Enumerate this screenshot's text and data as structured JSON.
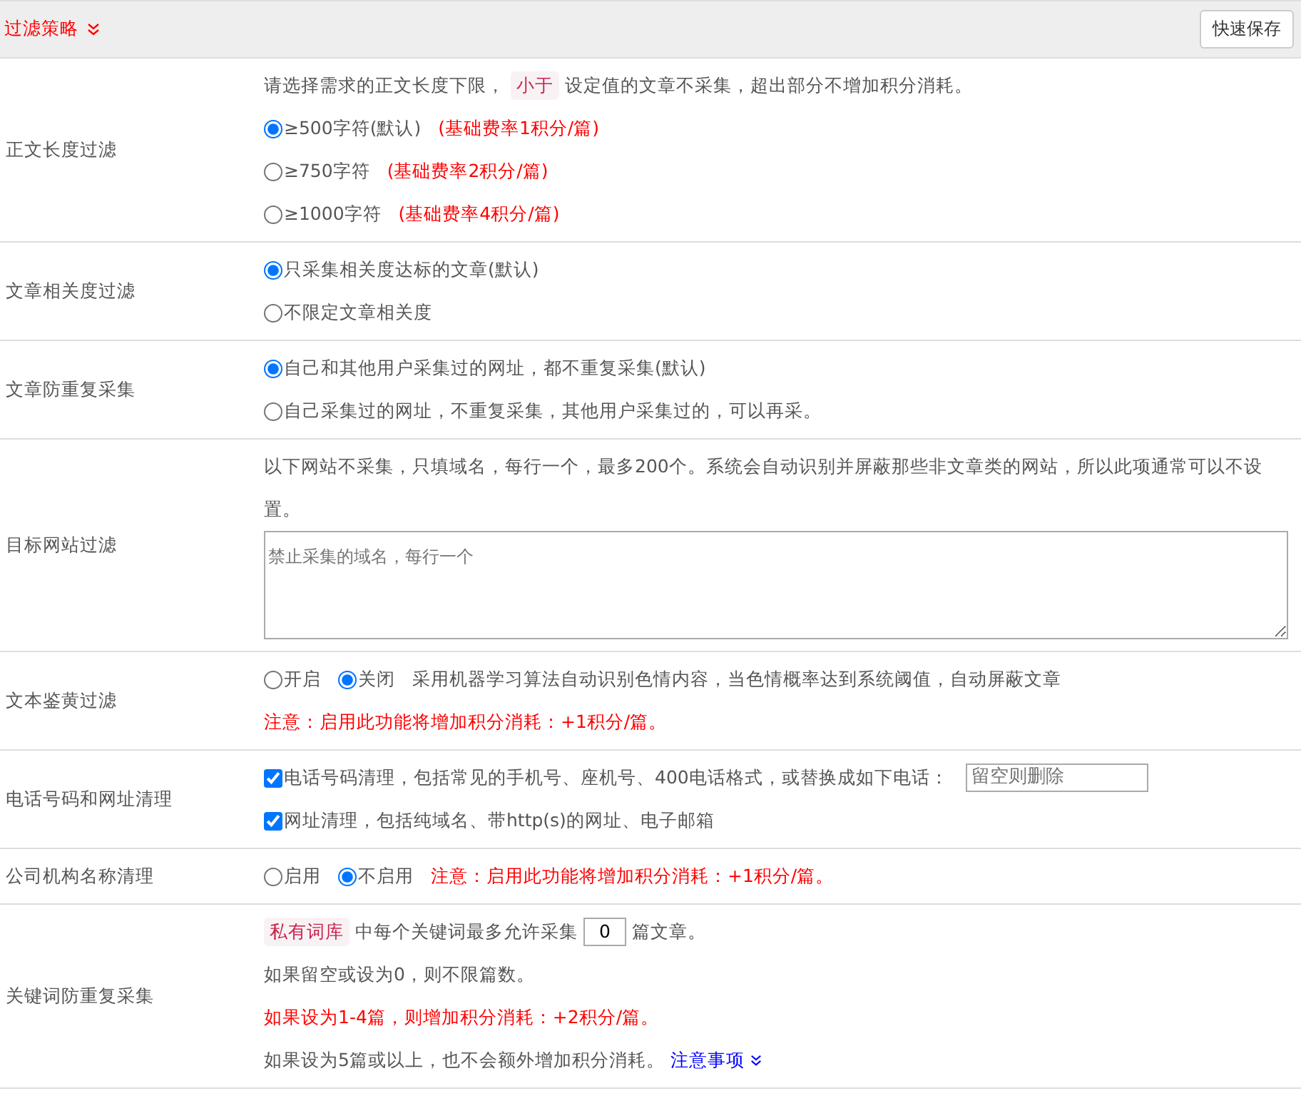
{
  "header": {
    "title": "过滤策略",
    "save_button": "快速保存"
  },
  "rows": [
    {
      "label": "正文长度过滤",
      "lines": [
        [
          {
            "kind": "text",
            "text": "请选择需求的正文长度下限，"
          },
          {
            "kind": "tag",
            "text": "小于"
          },
          {
            "kind": "text",
            "text": "设定值的文章不采集，超出部分不增加积分消耗。"
          }
        ],
        [
          {
            "kind": "radio",
            "label": "≥500字符(默认)",
            "selected": true
          },
          {
            "kind": "notice",
            "text": "(基础费率1积分/篇)"
          }
        ],
        [
          {
            "kind": "radio",
            "label": "≥750字符",
            "selected": false
          },
          {
            "kind": "notice",
            "text": "(基础费率2积分/篇)"
          }
        ],
        [
          {
            "kind": "radio",
            "label": "≥1000字符",
            "selected": false
          },
          {
            "kind": "notice",
            "text": "(基础费率4积分/篇)"
          }
        ]
      ]
    },
    {
      "label": "文章相关度过滤",
      "lines": [
        [
          {
            "kind": "radio",
            "label": "只采集相关度达标的文章(默认)",
            "selected": true
          }
        ],
        [
          {
            "kind": "radio",
            "label": "不限定文章相关度",
            "selected": false
          }
        ]
      ]
    },
    {
      "label": "文章防重复采集",
      "lines": [
        [
          {
            "kind": "radio",
            "label": "自己和其他用户采集过的网址，都不重复采集(默认)",
            "selected": true
          }
        ],
        [
          {
            "kind": "radio",
            "label": "自己采集过的网址，不重复采集，其他用户采集过的，可以再采。",
            "selected": false
          }
        ]
      ]
    },
    {
      "label": "目标网站过滤",
      "lines": [
        [
          {
            "kind": "text",
            "text": "以下网站不采集，只填域名，每行一个，最多200个。系统会自动识别并屏蔽那些非文章类的网站，所以此项通常可以不设置。"
          }
        ],
        [
          {
            "kind": "textarea",
            "placeholder": "禁止采集的域名，每行一个"
          }
        ]
      ]
    },
    {
      "label": "文本鉴黄过滤",
      "lines": [
        [
          {
            "kind": "radio",
            "label": "开启",
            "selected": false
          },
          {
            "kind": "radio",
            "label": "关闭",
            "selected": true
          },
          {
            "kind": "text",
            "text": "采用机器学习算法自动识别色情内容，当色情概率达到系统阈值，自动屏蔽文章"
          }
        ],
        [
          {
            "kind": "notice",
            "text": "注意：启用此功能将增加积分消耗：+1积分/篇。"
          }
        ]
      ]
    },
    {
      "label": "电话号码和网址清理",
      "lines": [
        [
          {
            "kind": "checkbox",
            "label": "电话号码清理，包括常见的手机号、座机号、400电话格式，或替换成如下电话：",
            "checked": true
          },
          {
            "kind": "input",
            "placeholder": "留空则删除"
          }
        ],
        [
          {
            "kind": "checkbox",
            "label": "网址清理，包括纯域名、带http(s)的网址、电子邮箱",
            "checked": true
          }
        ]
      ]
    },
    {
      "label": "公司机构名称清理",
      "lines": [
        [
          {
            "kind": "radio",
            "label": "启用",
            "selected": false
          },
          {
            "kind": "radio",
            "label": "不启用",
            "selected": true
          },
          {
            "kind": "notice",
            "text": "注意：启用此功能将增加积分消耗：+1积分/篇。"
          }
        ]
      ]
    },
    {
      "label": "关键词防重复采集",
      "lines": [
        [
          {
            "kind": "tag",
            "text": "私有词库"
          },
          {
            "kind": "text",
            "text": "中每个关键词最多允许采集"
          },
          {
            "kind": "number",
            "value": "0"
          },
          {
            "kind": "text",
            "text": "篇文章。"
          }
        ],
        [
          {
            "kind": "text",
            "text": "如果留空或设为0，则不限篇数。"
          }
        ],
        [
          {
            "kind": "notice",
            "text": "如果设为1-4篇，则增加积分消耗：+2积分/篇。"
          }
        ],
        [
          {
            "kind": "text",
            "text": "如果设为5篇或以上，也不会额外增加积分消耗。"
          },
          {
            "kind": "link",
            "text": "注意事项"
          }
        ]
      ]
    }
  ]
}
